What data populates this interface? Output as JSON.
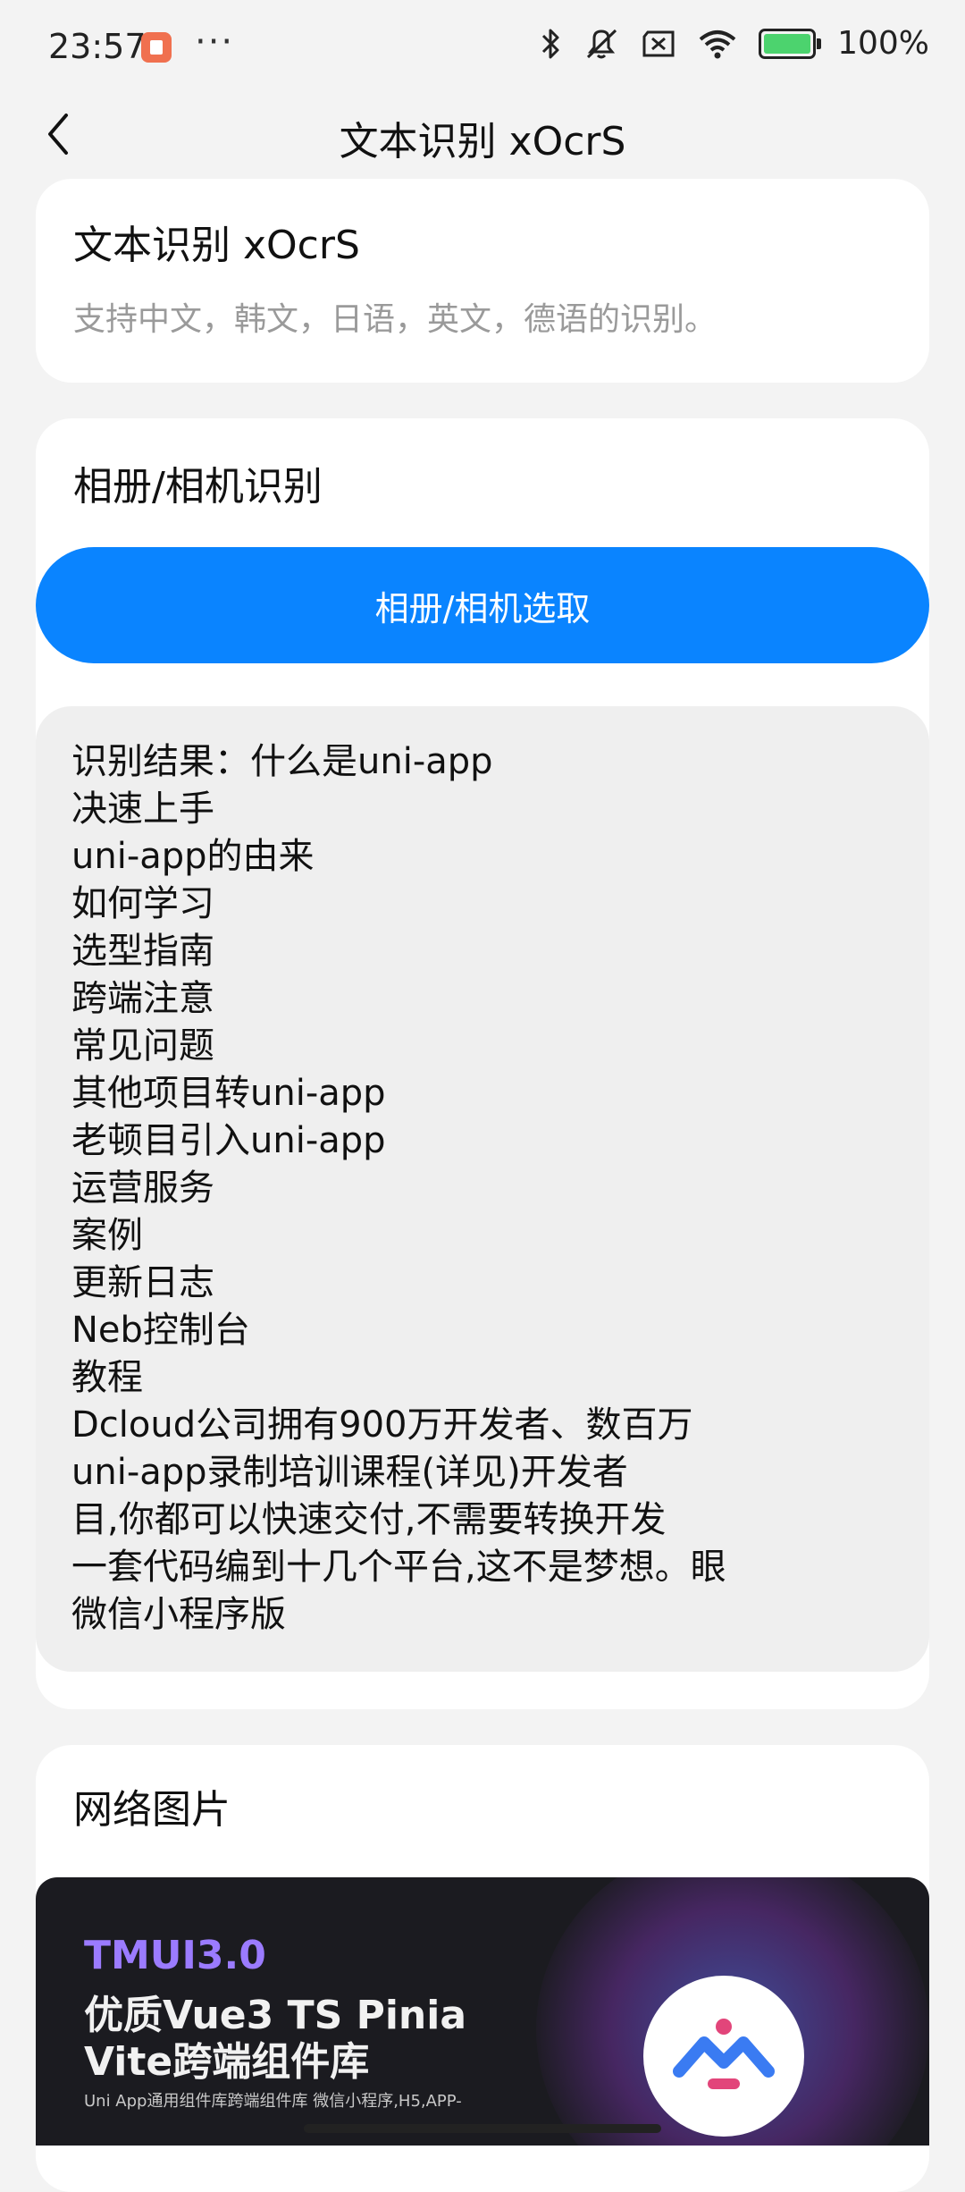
{
  "status_bar": {
    "time": "23:57",
    "more": "···",
    "battery": "100%",
    "icons": [
      "bluetooth-icon",
      "mute-icon",
      "no-sim-icon",
      "wifi-icon",
      "battery-icon"
    ]
  },
  "nav": {
    "title": "文本识别 xOcrS"
  },
  "intro_card": {
    "title": "文本识别 xOcrS",
    "description": "支持中文，韩文，日语，英文，德语的识别。"
  },
  "album_card": {
    "title": "相册/相机识别",
    "button_label": "相册/相机选取",
    "result_lines": [
      " 识别结果：什么是uni-app",
      "决速上手",
      "uni-app的由来",
      "如何学习",
      "选型指南",
      "跨端注意",
      "常见问题",
      "其他项目转uni-app",
      "老顿目引入uni-app",
      "运营服务",
      "案例",
      "更新日志",
      "Neb控制台",
      "教程",
      "Dcloud公司拥有900万开发者、数百万",
      "uni-app录制培训课程(详见)开发者",
      "目,你都可以快速交付,不需要转换开发",
      "一套代码编到十几个平台,这不是梦想。眼",
      "微信小程序版"
    ]
  },
  "network_card": {
    "title": "网络图片",
    "banner": {
      "brand": "TMUI3.0",
      "line1": "优质Vue3 TS Pinia",
      "line2": "Vite跨端组件库",
      "subtitle": "Uni App通用组件库跨端组件库 微信小程序,H5,APP-"
    }
  },
  "colors": {
    "accent": "#0a84ff",
    "background": "#f3f3f3",
    "card": "#ffffff",
    "result_bg": "#efefef"
  }
}
